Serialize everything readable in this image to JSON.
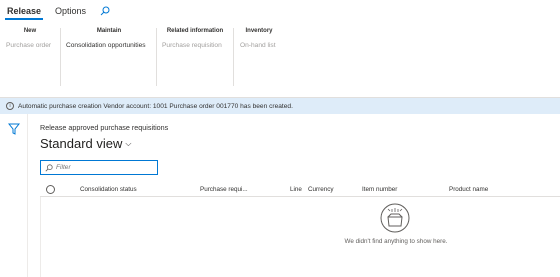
{
  "tabs": [
    {
      "label": "Release",
      "active": true
    },
    {
      "label": "Options",
      "active": false
    }
  ],
  "ribbon": {
    "groups": [
      {
        "title": "New",
        "items": [
          {
            "label": "Purchase order",
            "enabled": false
          }
        ]
      },
      {
        "title": "Maintain",
        "items": [
          {
            "label": "Consolidation opportunities",
            "enabled": true
          }
        ]
      },
      {
        "title": "Related information",
        "items": [
          {
            "label": "Purchase requisition",
            "enabled": false
          }
        ]
      },
      {
        "title": "Inventory",
        "items": [
          {
            "label": "On-hand list",
            "enabled": false
          }
        ]
      }
    ]
  },
  "message": {
    "text": "Automatic purchase creation   Vendor account: 1001 Purchase order 001770 has been created."
  },
  "page": {
    "caption": "Release approved purchase requisitions",
    "view_name": "Standard view",
    "filter_placeholder": "Filter"
  },
  "grid": {
    "columns": [
      "Consolidation status",
      "Purchase requi...",
      "Line",
      "Currency",
      "Item number",
      "Product name"
    ],
    "rows": [],
    "empty_message": "We didn't find anything to show here."
  },
  "colors": {
    "accent": "#0078d4",
    "message_bg": "#deecf9"
  },
  "icons": [
    "search-icon",
    "info-icon",
    "filter-icon",
    "chevron-down-icon",
    "empty-box-icon"
  ]
}
